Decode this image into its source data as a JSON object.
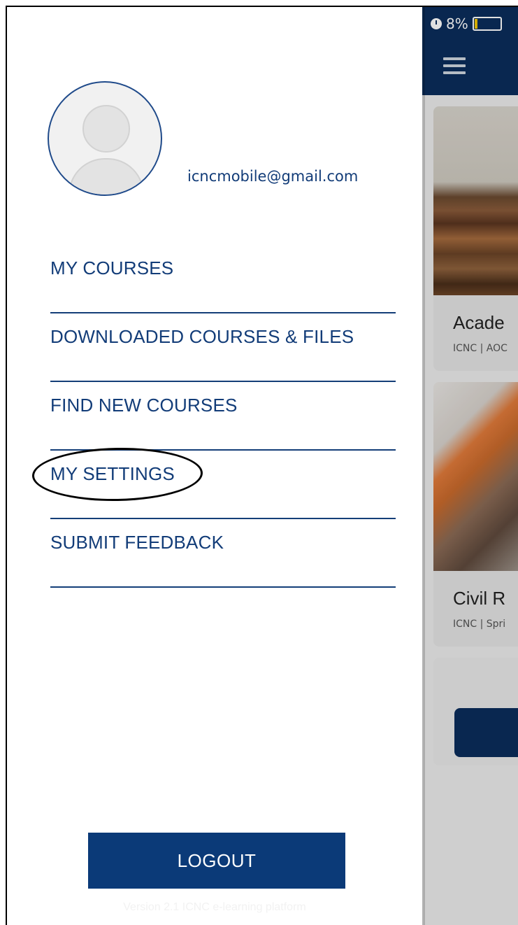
{
  "status_bar": {
    "battery_percent": "8%",
    "battery_level": 0.08,
    "icons": [
      "alarm-icon",
      "battery-icon"
    ]
  },
  "background": {
    "menu_icon": "hamburger-icon",
    "cards": [
      {
        "title": "Acade",
        "subtitle": "ICNC | AOC"
      },
      {
        "title": "Civil R",
        "subtitle": "ICNC | Spri"
      }
    ]
  },
  "profile": {
    "name": "",
    "email": "icncmobile@gmail.com",
    "avatar_icon": "default-avatar-icon"
  },
  "menu": {
    "items": [
      {
        "label": "MY COURSES"
      },
      {
        "label": "DOWNLOADED COURSES & FILES"
      },
      {
        "label": "FIND NEW COURSES"
      },
      {
        "label": "MY SETTINGS"
      },
      {
        "label": "SUBMIT FEEDBACK"
      }
    ]
  },
  "logout_label": "LOGOUT",
  "version_text": "Version 2.1 ICNC e-learning platform",
  "colors": {
    "brand_navy": "#0b2d5c",
    "menu_text": "#123c78",
    "button_bg": "#0b3a78",
    "battery_low": "#f2c400"
  }
}
